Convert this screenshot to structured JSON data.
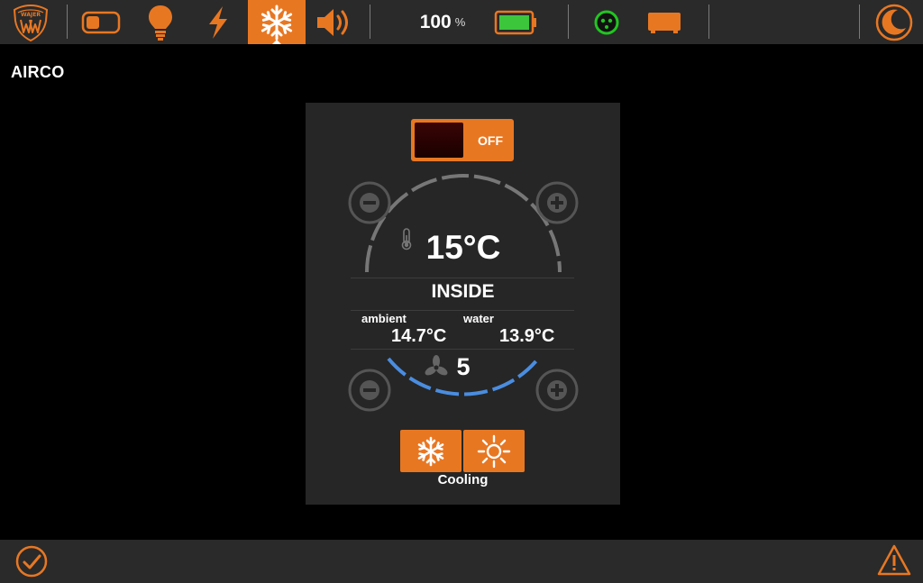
{
  "topbar": {
    "logo_icon": "wajer-logo-shield",
    "logo_text": "WAJER",
    "nav_items": [
      {
        "name": "switches",
        "icon": "toggle-switch-icon"
      },
      {
        "name": "lights",
        "icon": "light-bulb-icon"
      },
      {
        "name": "power",
        "icon": "lightning-bolt-icon"
      },
      {
        "name": "airco",
        "icon": "snowflake-icon",
        "active": true
      },
      {
        "name": "audio",
        "icon": "speaker-icon"
      }
    ],
    "battery": {
      "percent": "100",
      "unit": "%",
      "level": 1.0
    },
    "shore_power_icon": "shore-power-plug-icon",
    "generator_icon": "generator-icon",
    "night_mode_icon": "moon-icon"
  },
  "page": {
    "title": "AIRCO"
  },
  "airco": {
    "power_toggle": {
      "label": "OFF",
      "state": "off"
    },
    "setpoint": "15°C",
    "zone": "INSIDE",
    "ambient_label": "ambient",
    "ambient_value": "14.7°C",
    "water_label": "water",
    "water_value": "13.9°C",
    "fan_speed": "5",
    "mode_label": "Cooling",
    "modes": [
      "cooling",
      "heating"
    ]
  },
  "bottombar": {
    "status_icon": "check-circle-icon",
    "alert_icon": "warning-triangle-icon"
  },
  "colors": {
    "accent": "#e87722",
    "bar_bg": "#2a2a2a",
    "panel_bg": "#262626",
    "fan_arc": "#4a8de0",
    "temp_arc": "#777777",
    "battery_fill": "#3cc63c",
    "shore_power": "#22c422"
  }
}
